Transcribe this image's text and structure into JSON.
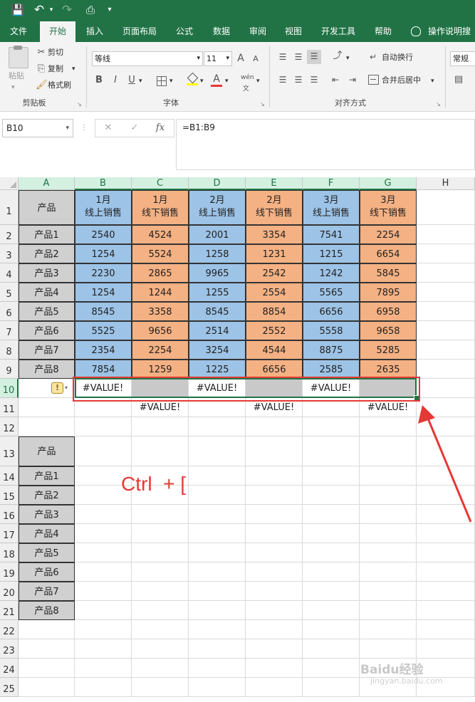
{
  "quick_access": {
    "save": "💾",
    "undo": "↶",
    "redo": "↷",
    "touch": "⎙",
    "more": "▾"
  },
  "tabs": [
    "文件",
    "开始",
    "插入",
    "页面布局",
    "公式",
    "数据",
    "审阅",
    "视图",
    "开发工具",
    "帮助"
  ],
  "tell_me": "操作说明搜",
  "clipboard": {
    "paste": "粘贴",
    "cut": "剪切",
    "copy": "复制",
    "format_painter": "格式刷",
    "group": "剪贴板"
  },
  "font": {
    "name": "等线",
    "size": "11",
    "bold": "B",
    "italic": "I",
    "underline": "U",
    "group": "字体",
    "grow": "A",
    "shrink": "A"
  },
  "alignment": {
    "wrap": "自动换行",
    "merge": "合并后居中",
    "group": "对齐方式"
  },
  "number": {
    "format": "常规"
  },
  "formula_bar": {
    "name_box": "B10",
    "cancel": "✕",
    "enter": "✓",
    "fx": "fx",
    "formula": "=B1:B9"
  },
  "columns": [
    "A",
    "B",
    "C",
    "D",
    "E",
    "F",
    "G",
    "H"
  ],
  "rows": [
    "1",
    "2",
    "3",
    "4",
    "5",
    "6",
    "7",
    "8",
    "9",
    "10",
    "11",
    "12",
    "13",
    "14",
    "15",
    "16",
    "17",
    "18",
    "19",
    "20",
    "21",
    "22",
    "23",
    "24",
    "25"
  ],
  "table": {
    "corner": "产品",
    "headers": [
      [
        "1月",
        "线上销售"
      ],
      [
        "1月",
        "线下销售"
      ],
      [
        "2月",
        "线上销售"
      ],
      [
        "2月",
        "线下销售"
      ],
      [
        "3月",
        "线上销售"
      ],
      [
        "3月",
        "线下销售"
      ]
    ],
    "products": [
      "产品1",
      "产品2",
      "产品3",
      "产品4",
      "产品5",
      "产品6",
      "产品7",
      "产品8"
    ],
    "values": [
      [
        2540,
        4524,
        2001,
        3354,
        7541,
        2254
      ],
      [
        1254,
        5524,
        1258,
        1231,
        1215,
        6654
      ],
      [
        2230,
        2865,
        9965,
        2542,
        1242,
        5845
      ],
      [
        1254,
        1244,
        1255,
        2554,
        5565,
        7895
      ],
      [
        8545,
        3358,
        8545,
        8854,
        6656,
        6958
      ],
      [
        5525,
        9656,
        2514,
        2552,
        5558,
        9658
      ],
      [
        2354,
        2254,
        3254,
        4544,
        8875,
        5285
      ],
      [
        7854,
        1259,
        1225,
        6656,
        2585,
        2635
      ]
    ]
  },
  "row10": [
    "#VALUE!",
    "",
    "#VALUE!",
    "",
    "#VALUE!",
    ""
  ],
  "row11": [
    "",
    "#VALUE!",
    "",
    "#VALUE!",
    "",
    "#VALUE!"
  ],
  "lower_table": {
    "header": "产品",
    "products": [
      "产品1",
      "产品2",
      "产品3",
      "产品4",
      "产品5",
      "产品6",
      "产品7",
      "产品8"
    ]
  },
  "annotation": {
    "text": "Ctrl  + [",
    "color": "#e53935"
  },
  "warning_icon": "!",
  "watermark": {
    "logo": "Baidu经验",
    "url": "jingyan.baidu.com"
  },
  "colors": {
    "excel_green": "#217346",
    "blue_fill": "#9dc3e6",
    "orange_fill": "#f4b183",
    "gray_fill": "#d0d0d0",
    "red": "#e53935"
  }
}
